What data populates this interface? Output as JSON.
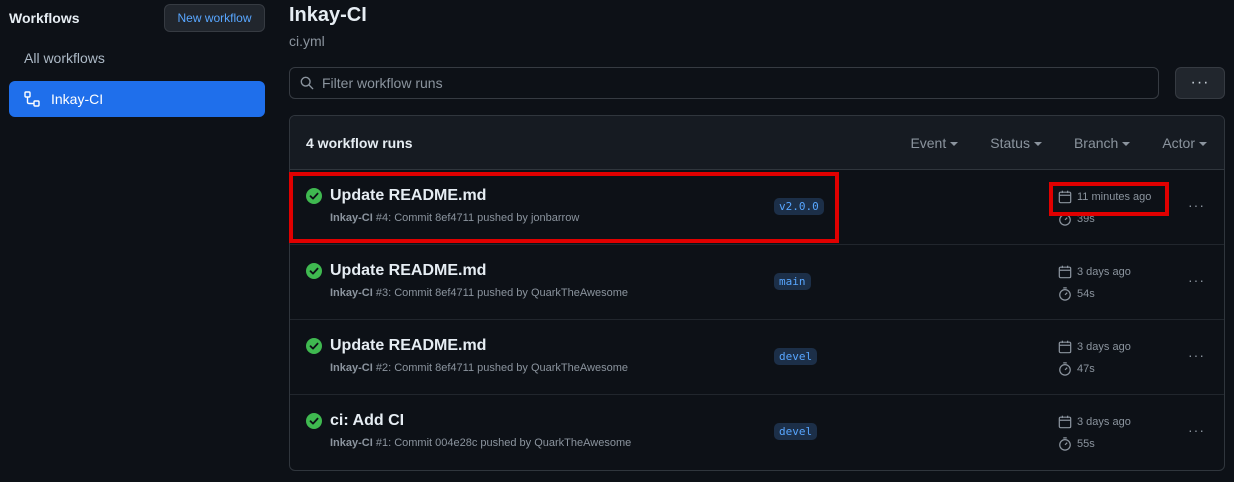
{
  "sidebar": {
    "title": "Workflows",
    "new_button": "New workflow",
    "all_workflows": "All workflows",
    "active_item": "Inkay-CI"
  },
  "header": {
    "title": "Inkay-CI",
    "subtitle": "ci.yml"
  },
  "filter": {
    "placeholder": "Filter workflow runs",
    "value": ""
  },
  "runs": {
    "count_label": "4 workflow runs",
    "filters": [
      "Event",
      "Status",
      "Branch",
      "Actor"
    ],
    "items": [
      {
        "title": "Update README.md",
        "workflow": "Inkay-CI",
        "details": " #4: Commit 8ef4711 pushed by jonbarrow",
        "branch": "v2.0.0",
        "when": "11 minutes ago",
        "duration": "39s"
      },
      {
        "title": "Update README.md",
        "workflow": "Inkay-CI",
        "details": " #3: Commit 8ef4711 pushed by QuarkTheAwesome",
        "branch": "main",
        "when": "3 days ago",
        "duration": "54s"
      },
      {
        "title": "Update README.md",
        "workflow": "Inkay-CI",
        "details": " #2: Commit 8ef4711 pushed by QuarkTheAwesome",
        "branch": "devel",
        "when": "3 days ago",
        "duration": "47s"
      },
      {
        "title": "ci: Add CI",
        "workflow": "Inkay-CI",
        "details": " #1: Commit 004e28c pushed by QuarkTheAwesome",
        "branch": "devel",
        "when": "3 days ago",
        "duration": "55s"
      }
    ]
  },
  "colors": {
    "success": "#3fb950",
    "accent": "#1f6feb",
    "highlight": "#e00000"
  }
}
